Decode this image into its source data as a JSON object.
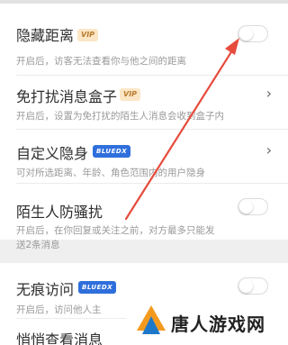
{
  "settings": {
    "hide_distance": {
      "title": "隐藏距离",
      "badge": "VIP",
      "desc": "开启后，访客无法查看你与他之间的距离",
      "enabled": false
    },
    "dnd_box": {
      "title": "免打扰消息盒子",
      "badge": "VIP",
      "desc": "开启后，设置为免打扰的陌生人消息会收到盒子内"
    },
    "custom_hide": {
      "title": "自定义隐身",
      "badge": "BLUEDX",
      "desc": "可对所选距离、年龄、角色范围内的用户隐身"
    },
    "stranger_guard": {
      "title": "陌生人防骚扰",
      "desc_line1": "开启后，在你回复或关注之前，对方最多只能发",
      "desc_line2": "送2条消息",
      "enabled": false
    },
    "trace_free": {
      "title": "无痕访问",
      "badge": "BLUEDX",
      "desc": "开启后，访问他人主",
      "enabled": false
    },
    "cut_off": {
      "title": "悄悄查看消息"
    }
  },
  "watermark": {
    "text": "唐人游戏网"
  },
  "colors": {
    "vip_bg": "#fbe6c6",
    "vip_text": "#b87a2b",
    "bluedx_bg": "#2f6fdc",
    "arrow": "#e64b3c",
    "logo_orange": "#f39a1e",
    "logo_blue": "#1e78c8"
  },
  "icons": {
    "chevron": "chevron-right-icon",
    "annotation": "red-arrow-annotation"
  }
}
